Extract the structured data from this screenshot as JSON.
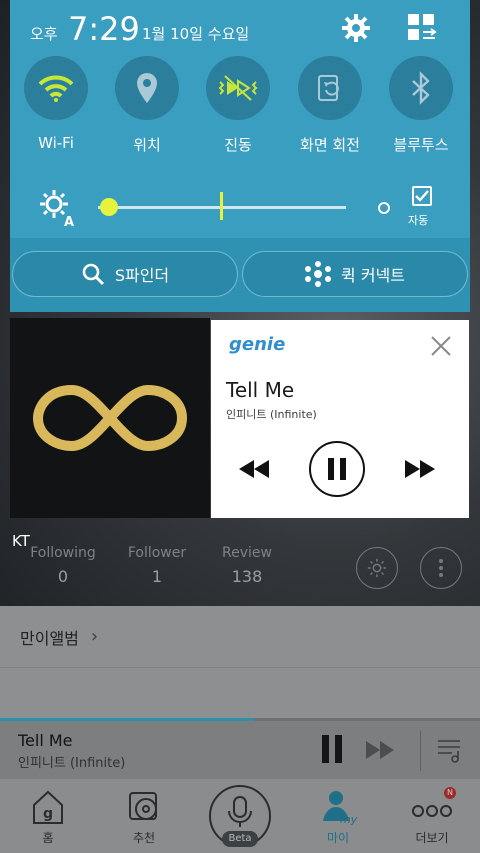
{
  "status": {
    "ampm": "오후",
    "time": "7:29",
    "date": "1월 10일 수요일"
  },
  "toggles": {
    "wifi": "Wi-Fi",
    "location": "위치",
    "vibrate": "진동",
    "rotate": "화면 회전",
    "bluetooth": "블루투스"
  },
  "brightness": {
    "auto_label": "자동",
    "level": 0.05
  },
  "shade_buttons": {
    "sfinder": "S파인더",
    "quick_connect": "퀵 커넥트"
  },
  "widget": {
    "app": "genie",
    "title": "Tell Me",
    "artist": "인피니트 (Infinite)"
  },
  "carrier": "KT",
  "profile_stats": {
    "following_label": "Following",
    "following_value": "0",
    "follower_label": "Follower",
    "follower_value": "1",
    "review_label": "Review",
    "review_value": "138"
  },
  "album_row": {
    "label": "만이앨범"
  },
  "mini_player": {
    "title": "Tell Me",
    "artist": "인피니트 (Infinite)",
    "progress": 0.53
  },
  "bottom_nav": {
    "home": "홈",
    "recommend": "추천",
    "beta": "Beta",
    "my": "마이",
    "more": "더보기",
    "badge": "N"
  },
  "colors": {
    "shade_bg": "#3a9ec1",
    "toggle_active": "#c8e63a",
    "accent": "#2e8fa8"
  }
}
